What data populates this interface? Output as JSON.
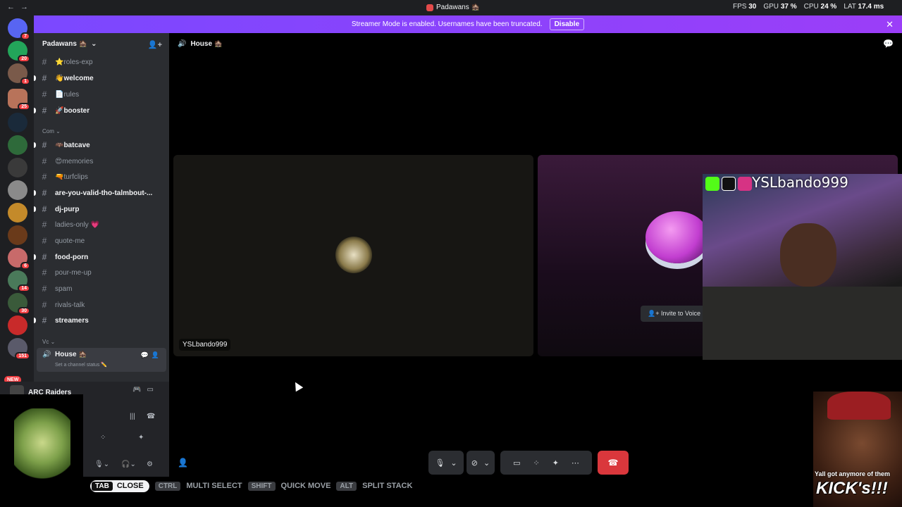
{
  "titlebar": {
    "title": "Padawans 🏚️",
    "fps_label": "FPS",
    "fps": "30",
    "gpu_label": "GPU",
    "gpu": "37 %",
    "cpu_label": "CPU",
    "cpu": "24 %",
    "lat_label": "LAT",
    "lat": "17.4 ms"
  },
  "banner": {
    "text": "Streamer Mode is enabled. Usernames have been truncated.",
    "button": "Disable"
  },
  "guild_badges": [
    "7",
    "20",
    "1",
    "25",
    "6",
    "14",
    "30",
    "151"
  ],
  "new_badge": "NEW",
  "server": {
    "name": "Padawans 🏚️"
  },
  "channels": [
    {
      "name": "⭐roles-exp",
      "unread": false
    },
    {
      "name": "👋welcome",
      "unread": true
    },
    {
      "name": "📄rules",
      "unread": false
    },
    {
      "name": "🚀booster",
      "unread": true
    },
    {
      "name": "🦇batcave",
      "unread": true
    },
    {
      "name": "😍memories",
      "unread": false
    },
    {
      "name": "🔫turfclips",
      "unread": false
    },
    {
      "name": "are-you-valid-tho-talmbout-...",
      "unread": true
    },
    {
      "name": "dj-purp",
      "unread": true
    },
    {
      "name": "ladies-only 💗",
      "unread": false
    },
    {
      "name": "quote-me",
      "unread": false
    },
    {
      "name": "food-porn",
      "unread": true
    },
    {
      "name": "pour-me-up",
      "unread": false
    },
    {
      "name": "spam",
      "unread": false
    },
    {
      "name": "rivals-talk",
      "unread": false
    },
    {
      "name": "streamers",
      "unread": true
    }
  ],
  "categories": {
    "com": "Com",
    "vc": "Vc"
  },
  "voice_channel": {
    "name": "House 🏚️",
    "status": "Set a channel status ✏️"
  },
  "game": {
    "name": "ARC Raiders"
  },
  "topbar": {
    "channel": "House 🏚️"
  },
  "tile1": {
    "name": "YSLbando999"
  },
  "tile2": {
    "invite": "Invite to Voice"
  },
  "cam": {
    "handle": "YSLbando999"
  },
  "meme": {
    "caption1": "Yall got anymore of them",
    "caption2": "KICK's!!!"
  },
  "hints": {
    "tab": "TAB",
    "close": "CLOSE",
    "ctrl": "CTRL",
    "multi": "MULTI SELECT",
    "shift": "SHIFT",
    "quick": "QUICK MOVE",
    "alt": "ALT",
    "split": "SPLIT STACK"
  },
  "colors": {
    "accent": "#5865f2",
    "banner": "#9b3ef8",
    "hangup": "#da373c",
    "online": "#23a55a"
  }
}
